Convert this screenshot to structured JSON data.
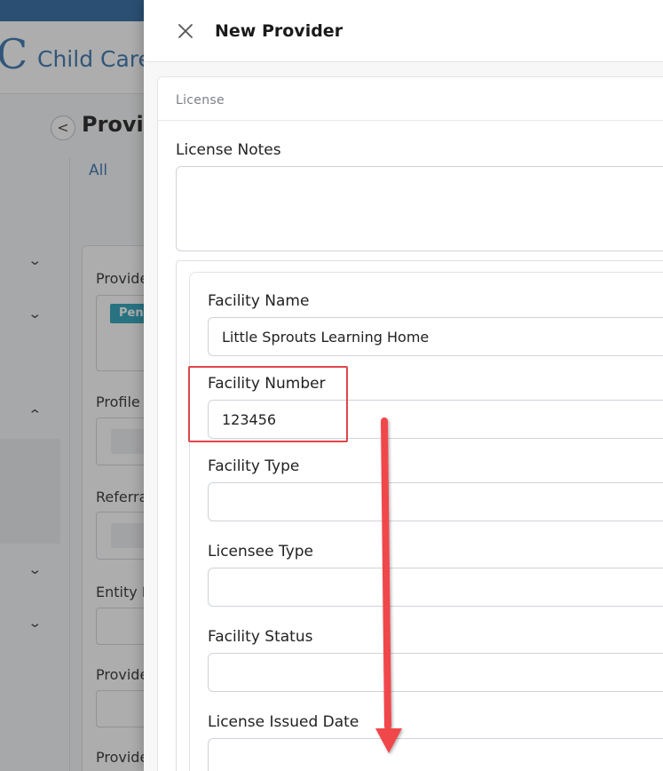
{
  "background": {
    "logo_letter": "C",
    "app_name": "Child Care",
    "back_button_glyph": "<",
    "page_title": "Provid",
    "tab_all": "All",
    "labels": [
      "Provide",
      "Profile",
      "Referra",
      "Entity I",
      "Provide",
      "Provide"
    ],
    "badge": "Pen"
  },
  "drawer": {
    "title": "New Provider",
    "close_icon": "close-icon"
  },
  "license": {
    "section_title": "License",
    "notes_label": "License Notes",
    "notes_value": "",
    "facility_name_label": "Facility Name",
    "facility_name_value": "Little Sprouts Learning Home",
    "facility_number_label": "Facility Number",
    "facility_number_value": "123456",
    "facility_type_label": "Facility Type",
    "facility_type_value": "",
    "licensee_type_label": "Licensee Type",
    "licensee_type_value": "",
    "facility_status_label": "Facility Status",
    "facility_status_value": "",
    "license_issued_date_label": "License Issued Date",
    "license_issued_date_value": ""
  },
  "annotations": {
    "highlight_color": "#e0464a",
    "arrow_color": "#f0474b"
  }
}
